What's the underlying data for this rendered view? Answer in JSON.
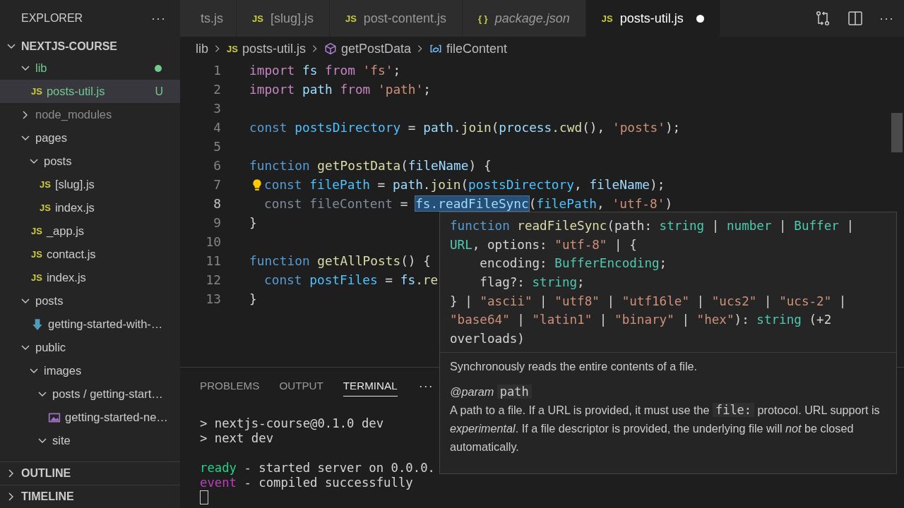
{
  "sidebar": {
    "title": "EXPLORER",
    "more": "···",
    "root": {
      "label": "NEXTJS-COURSE",
      "expanded": true
    },
    "tree": [
      {
        "label": "lib",
        "kind": "folder",
        "expanded": true,
        "selected": false,
        "color": "#73c991",
        "dot": true,
        "children": [
          {
            "label": "posts-util.js",
            "kind": "file",
            "icon": "JS",
            "selected": true,
            "color": "#73c991",
            "badge": "U"
          }
        ]
      },
      {
        "label": "node_modules",
        "kind": "folder",
        "expanded": false,
        "selected": false,
        "color": "#8c8c8c"
      },
      {
        "label": "pages",
        "kind": "folder",
        "expanded": true,
        "selected": false,
        "children": [
          {
            "label": "posts",
            "kind": "folder",
            "expanded": true,
            "selected": false,
            "children": [
              {
                "label": "[slug].js",
                "kind": "file",
                "icon": "JS",
                "selected": false
              },
              {
                "label": "index.js",
                "kind": "file",
                "icon": "JS",
                "selected": false
              }
            ]
          },
          {
            "label": "_app.js",
            "kind": "file",
            "icon": "JS",
            "selected": false
          },
          {
            "label": "contact.js",
            "kind": "file",
            "icon": "JS",
            "selected": false
          },
          {
            "label": "index.js",
            "kind": "file",
            "icon": "JS",
            "selected": false
          }
        ]
      },
      {
        "label": "posts",
        "kind": "folder",
        "expanded": true,
        "selected": false,
        "children": [
          {
            "label": "getting-started-with-…",
            "kind": "markdown",
            "selected": false
          }
        ]
      },
      {
        "label": "public",
        "kind": "folder",
        "expanded": true,
        "selected": false,
        "children": [
          {
            "label": "images",
            "kind": "folder",
            "expanded": true,
            "selected": false,
            "children": [
              {
                "label": "posts / getting-start…",
                "kind": "folder",
                "expanded": true,
                "selected": false,
                "children": [
                  {
                    "label": "getting-started-ne…",
                    "kind": "image",
                    "selected": false
                  }
                ]
              },
              {
                "label": "site",
                "kind": "folder",
                "expanded": true,
                "selected": false
              }
            ]
          }
        ]
      }
    ],
    "sections": [
      {
        "label": "OUTLINE",
        "expanded": false
      },
      {
        "label": "TIMELINE",
        "expanded": false
      }
    ]
  },
  "tabs": [
    {
      "label": "ts.js",
      "selected": false,
      "preview": false,
      "dirty": false
    },
    {
      "label": "[slug].js",
      "icon": "JS",
      "selected": false,
      "preview": false,
      "dirty": false
    },
    {
      "label": "post-content.js",
      "icon": "JS",
      "selected": false,
      "preview": false,
      "dirty": false
    },
    {
      "label": "package.json",
      "icon": "{ }",
      "selected": false,
      "preview": true,
      "dirty": false
    },
    {
      "label": "posts-util.js",
      "icon": "JS",
      "selected": true,
      "preview": false,
      "dirty": true
    }
  ],
  "tab_actions": {
    "more": "···"
  },
  "breadcrumb": [
    {
      "label": "lib",
      "kind": "folder"
    },
    {
      "label": "posts-util.js",
      "kind": "file",
      "icon": "JS"
    },
    {
      "label": "getPostData",
      "kind": "method"
    },
    {
      "label": "fileContent",
      "kind": "variable"
    }
  ],
  "code": [
    {
      "number": "1",
      "current": false,
      "lightbulb": false,
      "indented": false,
      "tokens": [
        {
          "kind": "control",
          "text": "import"
        },
        {
          "kind": "var",
          "text": " fs"
        },
        {
          "kind": "control",
          "text": " from"
        },
        {
          "kind": "string",
          "text": " 'fs'"
        },
        {
          "kind": "plain",
          "text": ";"
        }
      ]
    },
    {
      "number": "2",
      "current": false,
      "lightbulb": false,
      "indented": false,
      "tokens": [
        {
          "kind": "control",
          "text": "import"
        },
        {
          "kind": "var",
          "text": " path"
        },
        {
          "kind": "control",
          "text": " from"
        },
        {
          "kind": "string",
          "text": " 'path'"
        },
        {
          "kind": "plain",
          "text": ";"
        }
      ]
    },
    {
      "number": "3",
      "current": false,
      "lightbulb": false
    },
    {
      "number": "4",
      "current": false,
      "lightbulb": false,
      "indented": false,
      "tokens": [
        {
          "kind": "keyword",
          "text": "const"
        },
        {
          "kind": "const",
          "text": " postsDirectory"
        },
        {
          "kind": "plain",
          "text": " = "
        },
        {
          "kind": "var",
          "text": "path"
        },
        {
          "kind": "plain",
          "text": "."
        },
        {
          "kind": "function",
          "text": "join"
        },
        {
          "kind": "plain",
          "text": "("
        },
        {
          "kind": "var",
          "text": "process"
        },
        {
          "kind": "plain",
          "text": "."
        },
        {
          "kind": "function",
          "text": "cwd"
        },
        {
          "kind": "plain",
          "text": "(), "
        },
        {
          "kind": "string",
          "text": "'posts'"
        },
        {
          "kind": "plain",
          "text": ");"
        }
      ]
    },
    {
      "number": "5",
      "current": false,
      "lightbulb": false
    },
    {
      "number": "6",
      "current": false,
      "lightbulb": false,
      "indented": false,
      "tokens": [
        {
          "kind": "keyword",
          "text": "function"
        },
        {
          "kind": "function",
          "text": " getPostData"
        },
        {
          "kind": "plain",
          "text": "("
        },
        {
          "kind": "var",
          "text": "fileName"
        },
        {
          "kind": "plain",
          "text": ") {"
        }
      ]
    },
    {
      "number": "7",
      "current": false,
      "lightbulb": true,
      "indented": true,
      "tokens": [
        {
          "kind": "keyword",
          "text": "const"
        },
        {
          "kind": "const",
          "text": " filePath"
        },
        {
          "kind": "plain",
          "text": " = "
        },
        {
          "kind": "var",
          "text": "path"
        },
        {
          "kind": "plain",
          "text": "."
        },
        {
          "kind": "function",
          "text": "join"
        },
        {
          "kind": "plain",
          "text": "("
        },
        {
          "kind": "const",
          "text": "postsDirectory"
        },
        {
          "kind": "plain",
          "text": ", "
        },
        {
          "kind": "var",
          "text": "fileName"
        },
        {
          "kind": "plain",
          "text": ");"
        }
      ]
    },
    {
      "number": "8",
      "current": true,
      "lightbulb": false,
      "indented": true,
      "tokens": [
        {
          "kind": "unused",
          "text": "const fileContent"
        },
        {
          "kind": "plain",
          "text": " = "
        },
        {
          "kind": "var",
          "text": "fs.readFileSync",
          "highlight": true
        },
        {
          "kind": "plain",
          "text": "("
        },
        {
          "kind": "const",
          "text": "filePath"
        },
        {
          "kind": "plain",
          "text": ", "
        },
        {
          "kind": "string",
          "text": "'utf-8'"
        },
        {
          "kind": "plain",
          "text": ")"
        }
      ]
    },
    {
      "number": "9",
      "current": false,
      "lightbulb": false,
      "indented": false,
      "tokens": [
        {
          "kind": "plain",
          "text": "}"
        }
      ]
    },
    {
      "number": "10",
      "current": false,
      "lightbulb": false
    },
    {
      "number": "11",
      "current": false,
      "lightbulb": false,
      "indented": false,
      "tokens": [
        {
          "kind": "keyword",
          "text": "function"
        },
        {
          "kind": "function",
          "text": " getAllPosts"
        },
        {
          "kind": "plain",
          "text": "() {"
        }
      ]
    },
    {
      "number": "12",
      "current": false,
      "lightbulb": false,
      "indented": true,
      "tokens": [
        {
          "kind": "keyword",
          "text": "const"
        },
        {
          "kind": "const",
          "text": " postFiles"
        },
        {
          "kind": "plain",
          "text": " = "
        },
        {
          "kind": "var",
          "text": "fs"
        },
        {
          "kind": "plain",
          "text": "."
        },
        {
          "kind": "function",
          "text": "re"
        }
      ]
    },
    {
      "number": "13",
      "current": false,
      "lightbulb": false,
      "indented": false,
      "tokens": [
        {
          "kind": "plain",
          "text": "}"
        }
      ]
    }
  ],
  "hover": {
    "signature": [
      [
        {
          "kind": "keyword",
          "text": "function"
        },
        {
          "kind": "function",
          "text": " readFileSync"
        },
        {
          "kind": "plain",
          "text": "(path: "
        },
        {
          "kind": "type",
          "text": "string"
        },
        {
          "kind": "plain",
          "text": " | "
        },
        {
          "kind": "type",
          "text": "number"
        },
        {
          "kind": "plain",
          "text": " | "
        },
        {
          "kind": "type",
          "text": "Buffer"
        },
        {
          "kind": "plain",
          "text": " |"
        }
      ],
      [
        {
          "kind": "type",
          "text": "URL"
        },
        {
          "kind": "plain",
          "text": ", options: "
        },
        {
          "kind": "string",
          "text": "\"utf-8\""
        },
        {
          "kind": "plain",
          "text": " | {"
        }
      ],
      [
        {
          "kind": "plain",
          "text": "    encoding: "
        },
        {
          "kind": "type",
          "text": "BufferEncoding"
        },
        {
          "kind": "plain",
          "text": ";"
        }
      ],
      [
        {
          "kind": "plain",
          "text": "    flag?: "
        },
        {
          "kind": "type",
          "text": "string"
        },
        {
          "kind": "plain",
          "text": ";"
        }
      ],
      [
        {
          "kind": "plain",
          "text": "} | "
        },
        {
          "kind": "string",
          "text": "\"ascii\""
        },
        {
          "kind": "plain",
          "text": " | "
        },
        {
          "kind": "string",
          "text": "\"utf8\""
        },
        {
          "kind": "plain",
          "text": " | "
        },
        {
          "kind": "string",
          "text": "\"utf16le\""
        },
        {
          "kind": "plain",
          "text": " | "
        },
        {
          "kind": "string",
          "text": "\"ucs2\""
        },
        {
          "kind": "plain",
          "text": " | "
        },
        {
          "kind": "string",
          "text": "\"ucs-2\""
        },
        {
          "kind": "plain",
          "text": " |"
        }
      ],
      [
        {
          "kind": "string",
          "text": "\"base64\""
        },
        {
          "kind": "plain",
          "text": " | "
        },
        {
          "kind": "string",
          "text": "\"latin1\""
        },
        {
          "kind": "plain",
          "text": " | "
        },
        {
          "kind": "string",
          "text": "\"binary\""
        },
        {
          "kind": "plain",
          "text": " | "
        },
        {
          "kind": "string",
          "text": "\"hex\""
        },
        {
          "kind": "plain",
          "text": "): "
        },
        {
          "kind": "type",
          "text": "string"
        },
        {
          "kind": "plain",
          "text": " (+2"
        }
      ],
      [
        {
          "kind": "plain",
          "text": "overloads)"
        }
      ]
    ],
    "summary": "Synchronously reads the entire contents of a file.",
    "param": {
      "tag": "@param",
      "name": "path"
    },
    "description": [
      {
        "kind": "text",
        "text": "A path to a file. If a URL is provided, it must use the "
      },
      {
        "kind": "code",
        "text": "file:"
      },
      {
        "kind": "text",
        "text": " protocol. URL support is *experimental*. If a file descriptor is provided, the underlying file will *not* be closed automatically."
      }
    ]
  },
  "panel": {
    "tabs": [
      {
        "label": "PROBLEMS",
        "selected": false
      },
      {
        "label": "OUTPUT",
        "selected": false
      },
      {
        "label": "TERMINAL",
        "selected": true
      }
    ],
    "more": "···",
    "terminal": [
      [
        [
          {
            "kind": "plain",
            "text": "> nextjs-course@0.1.0 dev"
          }
        ],
        [
          {
            "kind": "plain",
            "text": "> next dev"
          }
        ]
      ],
      [
        [
          {
            "kind": "ready",
            "text": "ready"
          },
          {
            "kind": "plain",
            "text": " - started server on 0.0.0."
          }
        ],
        [
          {
            "kind": "event",
            "text": "event"
          },
          {
            "kind": "plain",
            "text": " - compiled successfully"
          }
        ]
      ]
    ]
  }
}
